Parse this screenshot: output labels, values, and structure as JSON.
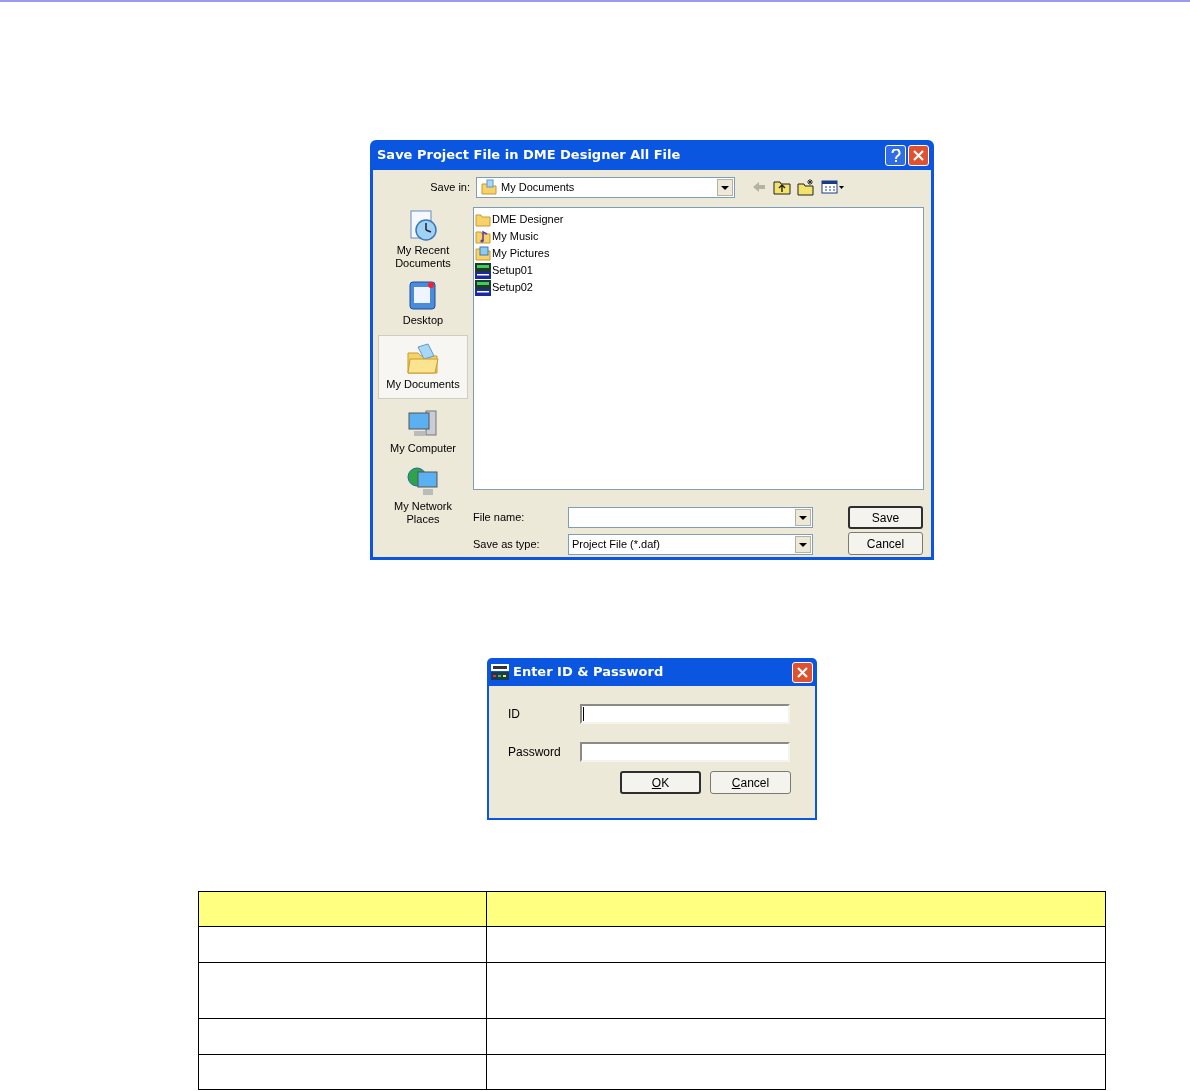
{
  "save_dialog": {
    "title": "Save Project File in DME Designer All File",
    "save_in": {
      "label": "Save in:",
      "value": "My Documents"
    },
    "places": [
      {
        "label": "My Recent Documents",
        "kind": "recent",
        "selected": false
      },
      {
        "label": "Desktop",
        "kind": "desktop",
        "selected": false
      },
      {
        "label": "My Documents",
        "kind": "documents",
        "selected": true
      },
      {
        "label": "My Computer",
        "kind": "computer",
        "selected": false
      },
      {
        "label": "My Network Places",
        "kind": "network",
        "selected": false
      }
    ],
    "files": [
      {
        "name": "DME Designer",
        "kind": "folder"
      },
      {
        "name": "My Music",
        "kind": "music"
      },
      {
        "name": "My Pictures",
        "kind": "pictures"
      },
      {
        "name": "Setup01",
        "kind": "file"
      },
      {
        "name": "Setup02",
        "kind": "file"
      }
    ],
    "fields": [
      {
        "label": "File name:"
      },
      {
        "label": "Save as type:",
        "value": "Project File (*.daf)"
      }
    ],
    "buttons": [
      {
        "label": "Save",
        "default": true
      },
      {
        "label": "Cancel",
        "default": false
      }
    ]
  },
  "login_dialog": {
    "title": "Enter ID & Password",
    "fields": [
      {
        "label": "ID",
        "focused": true
      },
      {
        "label": "Password",
        "focused": false
      }
    ],
    "buttons": [
      {
        "label": "OK",
        "default": true,
        "mnemonic": true
      },
      {
        "label": "Cancel",
        "default": false,
        "mnemonic": true
      }
    ]
  }
}
